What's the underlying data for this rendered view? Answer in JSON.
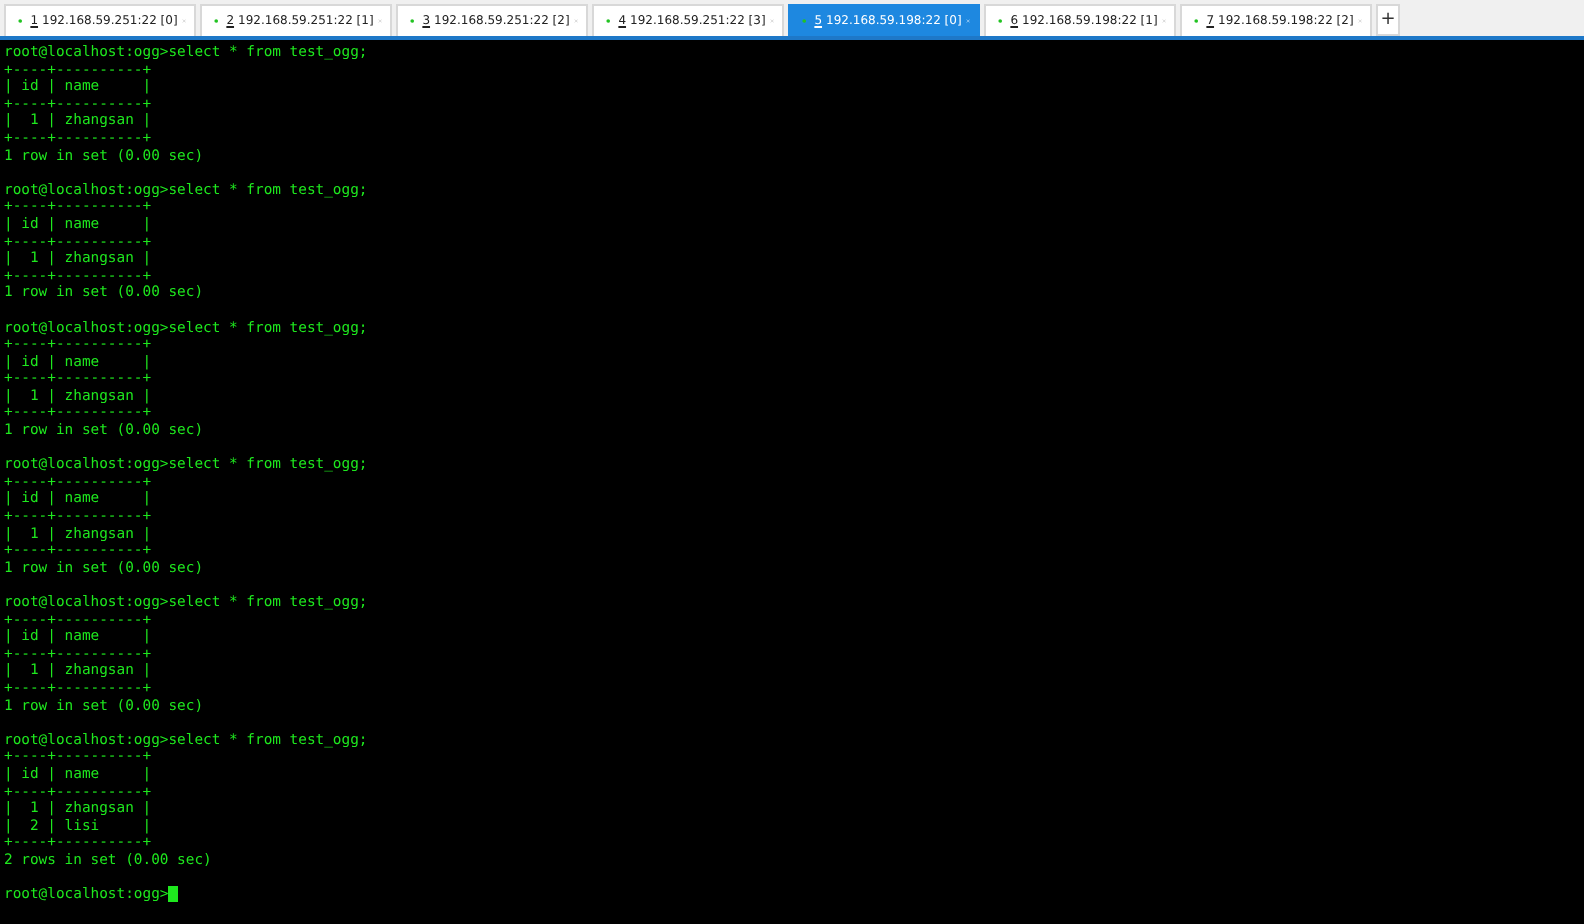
{
  "tabs": [
    {
      "number": "1",
      "label": "192.168.59.251:22 [0]",
      "selected": false
    },
    {
      "number": "2",
      "label": "192.168.59.251:22 [1]",
      "selected": false
    },
    {
      "number": "3",
      "label": "192.168.59.251:22 [2]",
      "selected": false
    },
    {
      "number": "4",
      "label": "192.168.59.251:22 [3]",
      "selected": false
    },
    {
      "number": "5",
      "label": "192.168.59.198:22 [0]",
      "selected": true
    },
    {
      "number": "6",
      "label": "192.168.59.198:22 [1]",
      "selected": false
    },
    {
      "number": "7",
      "label": "192.168.59.198:22 [2]",
      "selected": false
    }
  ],
  "new_tab": "+",
  "terminal": {
    "blocks": [
      [
        "root@localhost:ogg>select * from test_ogg;",
        "+----+----------+",
        "| id | name     |",
        "+----+----------+",
        "|  1 | zhangsan |",
        "+----+----------+",
        "1 row in set (0.00 sec)"
      ],
      [
        "root@localhost:ogg>select * from test_ogg;",
        "+----+----------+",
        "| id | name     |",
        "+----+----------+",
        "|  1 | zhangsan |",
        "+----+----------+",
        "1 row in set (0.00 sec)"
      ],
      [
        "root@localhost:ogg>select * from test_ogg;",
        "+----+----------+",
        "| id | name     |",
        "+----+----------+",
        "|  1 | zhangsan |",
        "+----+----------+",
        "1 row in set (0.00 sec)"
      ],
      [
        "root@localhost:ogg>select * from test_ogg;",
        "+----+----------+",
        "| id | name     |",
        "+----+----------+",
        "|  1 | zhangsan |",
        "+----+----------+",
        "1 row in set (0.00 sec)"
      ],
      [
        "root@localhost:ogg>select * from test_ogg;",
        "+----+----------+",
        "| id | name     |",
        "+----+----------+",
        "|  1 | zhangsan |",
        "+----+----------+",
        "1 row in set (0.00 sec)"
      ],
      [
        "root@localhost:ogg>select * from test_ogg;",
        "+----+----------+",
        "| id | name     |",
        "+----+----------+",
        "|  1 | zhangsan |",
        "|  2 | lisi     |",
        "+----+----------+",
        "2 rows in set (0.00 sec)"
      ]
    ],
    "prompt": "root@localhost:ogg>",
    "cursor": true
  }
}
